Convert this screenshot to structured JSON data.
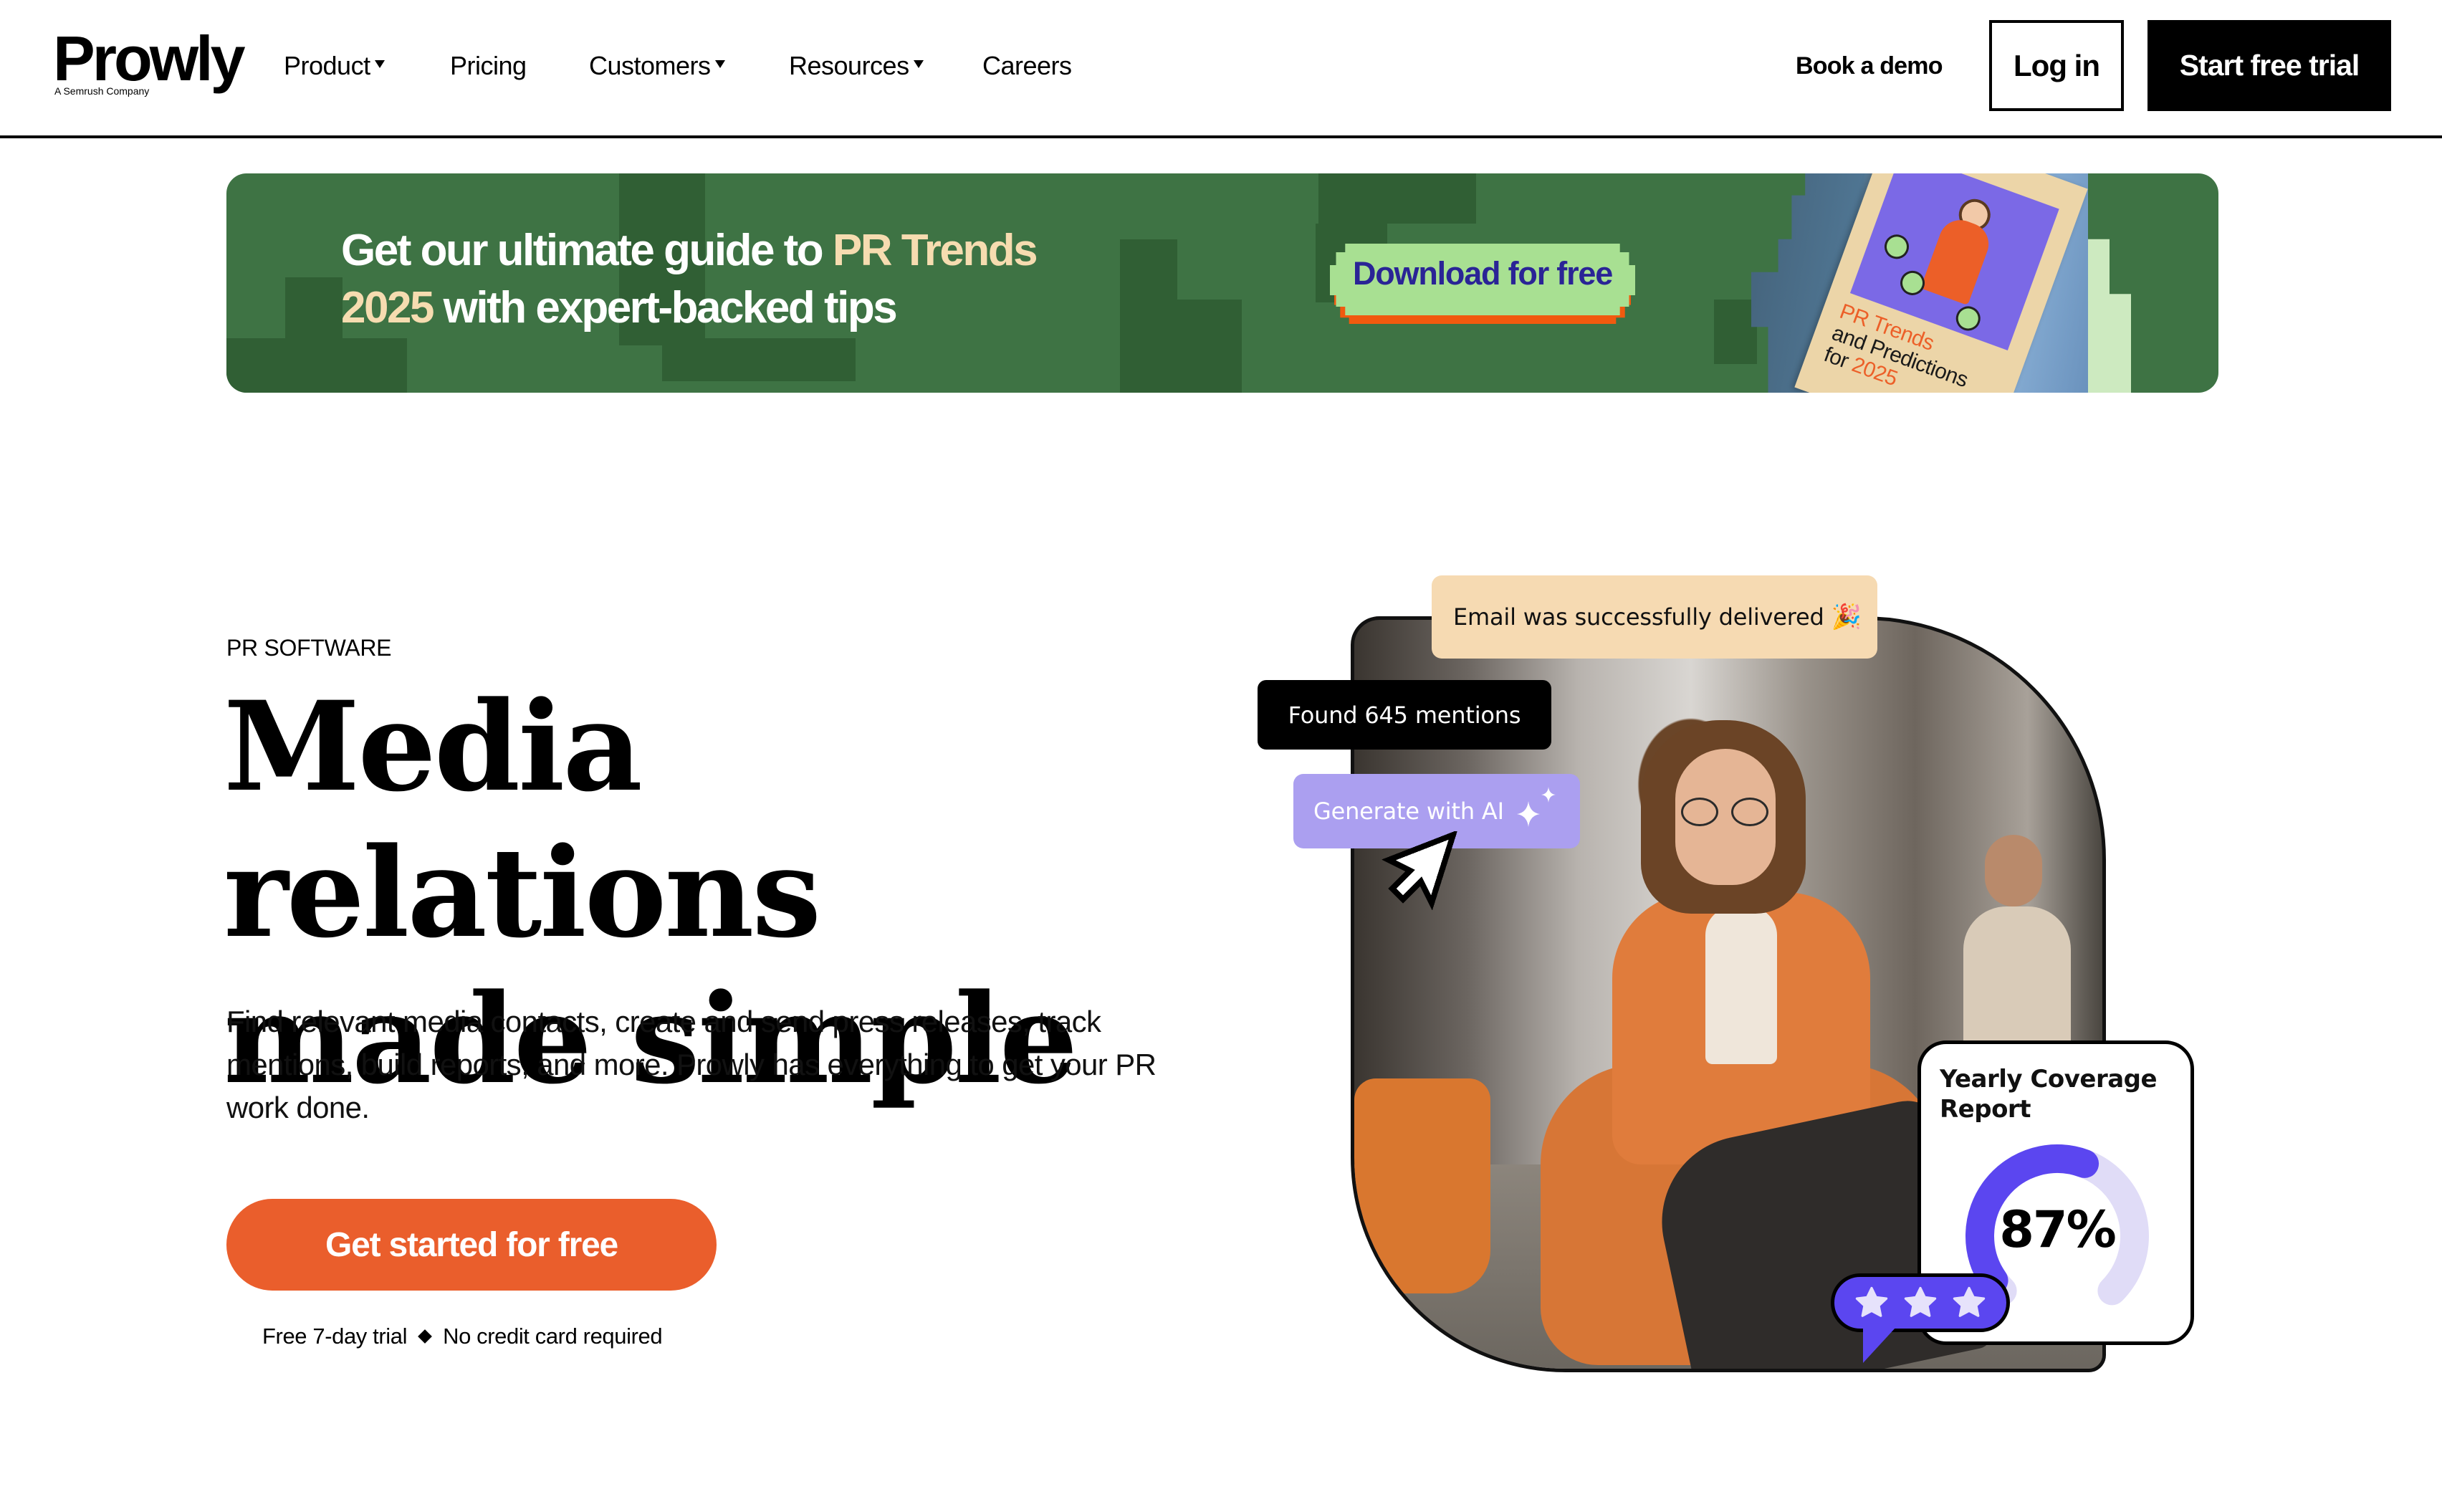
{
  "header": {
    "logo": {
      "wordmark": "Prowly",
      "tagline": "A Semrush Company"
    },
    "nav": [
      {
        "label": "Product",
        "has_dropdown": true
      },
      {
        "label": "Pricing",
        "has_dropdown": false
      },
      {
        "label": "Customers",
        "has_dropdown": true
      },
      {
        "label": "Resources",
        "has_dropdown": true
      },
      {
        "label": "Careers",
        "has_dropdown": false
      }
    ],
    "book_demo": "Book a demo",
    "login": "Log in",
    "start_trial": "Start free trial"
  },
  "banner": {
    "headline_pre": "Get our ultimate guide to ",
    "headline_accent": "PR Trends 2025",
    "headline_post": " with expert-backed tips",
    "button": "Download for free",
    "book_title_line1": "PR Trends",
    "book_title_line2": "and Predictions",
    "book_title_for": "for ",
    "book_title_year": "2025",
    "colors": {
      "bg": "#3e7344",
      "accent_text": "#f6dcb0",
      "button_bg": "#a8e092",
      "button_text": "#2a2496",
      "button_shadow": "#f15a0f"
    }
  },
  "hero": {
    "eyebrow": "PR SOFTWARE",
    "headline_line1": "Media relations",
    "headline_line2": "made simple",
    "lead": "Find relevant media contacts, create and send press releases, track mentions, build reports, and more. Prowly has everything to get your PR work done.",
    "cta": "Get started for free",
    "footnote_left": "Free 7-day trial",
    "footnote_right": "No credit card required",
    "colors": {
      "cta_bg": "#ea5e2c"
    }
  },
  "hero_visual": {
    "email_pill": "Email was successfully delivered",
    "email_emoji": "party-popper-icon",
    "found_pill": "Found 645 mentions",
    "ai_pill": "Generate with AI",
    "report_card": {
      "title": "Yearly Coverage Report",
      "value_label": "87%",
      "value_percent": 87,
      "colors": {
        "fill": "#5b46f0",
        "track": "#e0dcf7"
      }
    },
    "rating_stars": 3
  }
}
